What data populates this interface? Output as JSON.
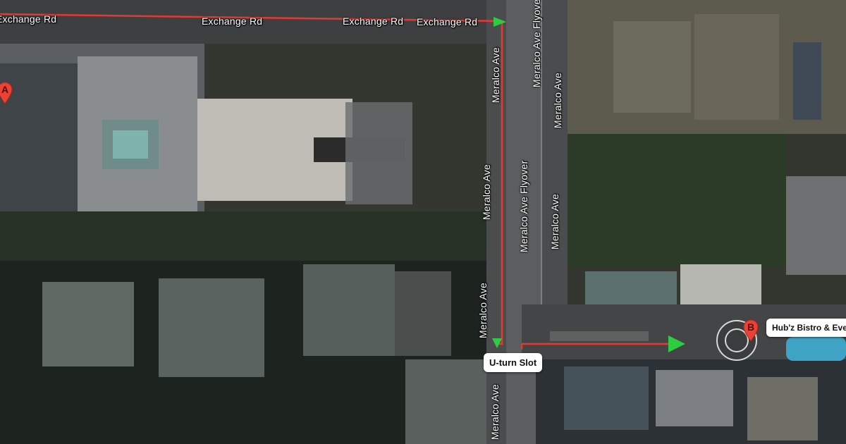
{
  "roads": {
    "exchange_1": "Exchange Rd",
    "exchange_2": "Exchange Rd",
    "exchange_3": "Exchange Rd",
    "exchange_4": "Exchange Rd",
    "meralco_ave_1": "Meralco Ave",
    "meralco_ave_2": "Meralco Ave",
    "meralco_ave_3": "Meralco Ave",
    "meralco_ave_4": "Meralco Ave",
    "meralco_ave_east_1": "Meralco Ave",
    "meralco_ave_east_2": "Meralco Ave",
    "flyover_1": "Meralco Ave Flyover",
    "flyover_2": "Meralco Ave Flyover"
  },
  "markers": {
    "a_letter": "A",
    "b_letter": "B",
    "b_label": "Hub'z Bistro & Eve"
  },
  "annotations": {
    "uturn_label": "U-turn Slot"
  },
  "colors": {
    "route": "#e53935",
    "arrow": "#2ecc40",
    "pin": "#ea4335"
  }
}
